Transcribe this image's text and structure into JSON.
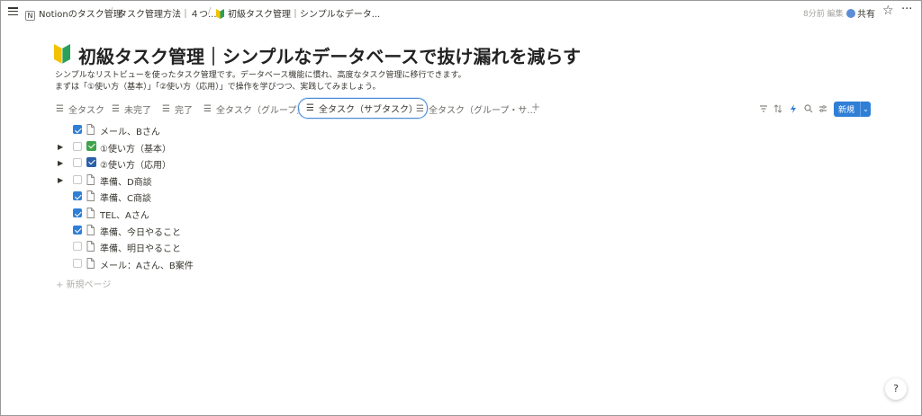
{
  "topbar": {
    "workspace_badge": "N",
    "crumb1": "Notionのタスク管理",
    "crumb2": "タスク管理方法｜４つ...",
    "crumb3": "初級タスク管理｜シンプルなデータ...",
    "edited": "8分前 編集",
    "share": "共有",
    "star_icon": "☆",
    "more_icon": "···"
  },
  "page": {
    "title": "初級タスク管理｜シンプルなデータベースで抜け漏れを減らす",
    "desc1": "シンプルなリストビューを使ったタスク管理です。データベース機能に慣れ、高度なタスク管理に移行できます。",
    "desc2": "まずは「①使い方（基本）」「②使い方（応用）」で操作を学びつつ、実践してみましょう。"
  },
  "tabs": [
    {
      "label": "全タスク"
    },
    {
      "label": "未完了"
    },
    {
      "label": "完了"
    },
    {
      "label": "全タスク（グループ）"
    },
    {
      "label": "全タスク（サブタスク）"
    },
    {
      "label": "全タスク（グループ・サ..."
    }
  ],
  "toolbar": {
    "add_view": "+",
    "new_label": "新規",
    "new_chevron": "⌄"
  },
  "rows": [
    {
      "title": "メール、Bさん",
      "checked": true,
      "icon": "doc",
      "toggle": false
    },
    {
      "title": "①使い方（基本）",
      "checked": false,
      "icon": "green-check",
      "toggle": true
    },
    {
      "title": "②使い方（応用）",
      "checked": false,
      "icon": "blue-check",
      "toggle": true
    },
    {
      "title": "準備、D商談",
      "checked": false,
      "icon": "doc",
      "toggle": true
    },
    {
      "title": "準備、C商談",
      "checked": true,
      "icon": "doc",
      "toggle": false
    },
    {
      "title": "TEL、Aさん",
      "checked": true,
      "icon": "doc",
      "toggle": false
    },
    {
      "title": "準備、今日やること",
      "checked": true,
      "icon": "doc",
      "toggle": false
    },
    {
      "title": "準備、明日やること",
      "checked": false,
      "icon": "doc",
      "toggle": false
    },
    {
      "title": "メール：Aさん、B案件",
      "checked": false,
      "icon": "doc",
      "toggle": false
    }
  ],
  "new_page_label": "+ 新規ページ",
  "help_label": "?",
  "colors": {
    "accent": "#2f7fd6",
    "text": "#37352f",
    "muted": "#6b6a66"
  }
}
